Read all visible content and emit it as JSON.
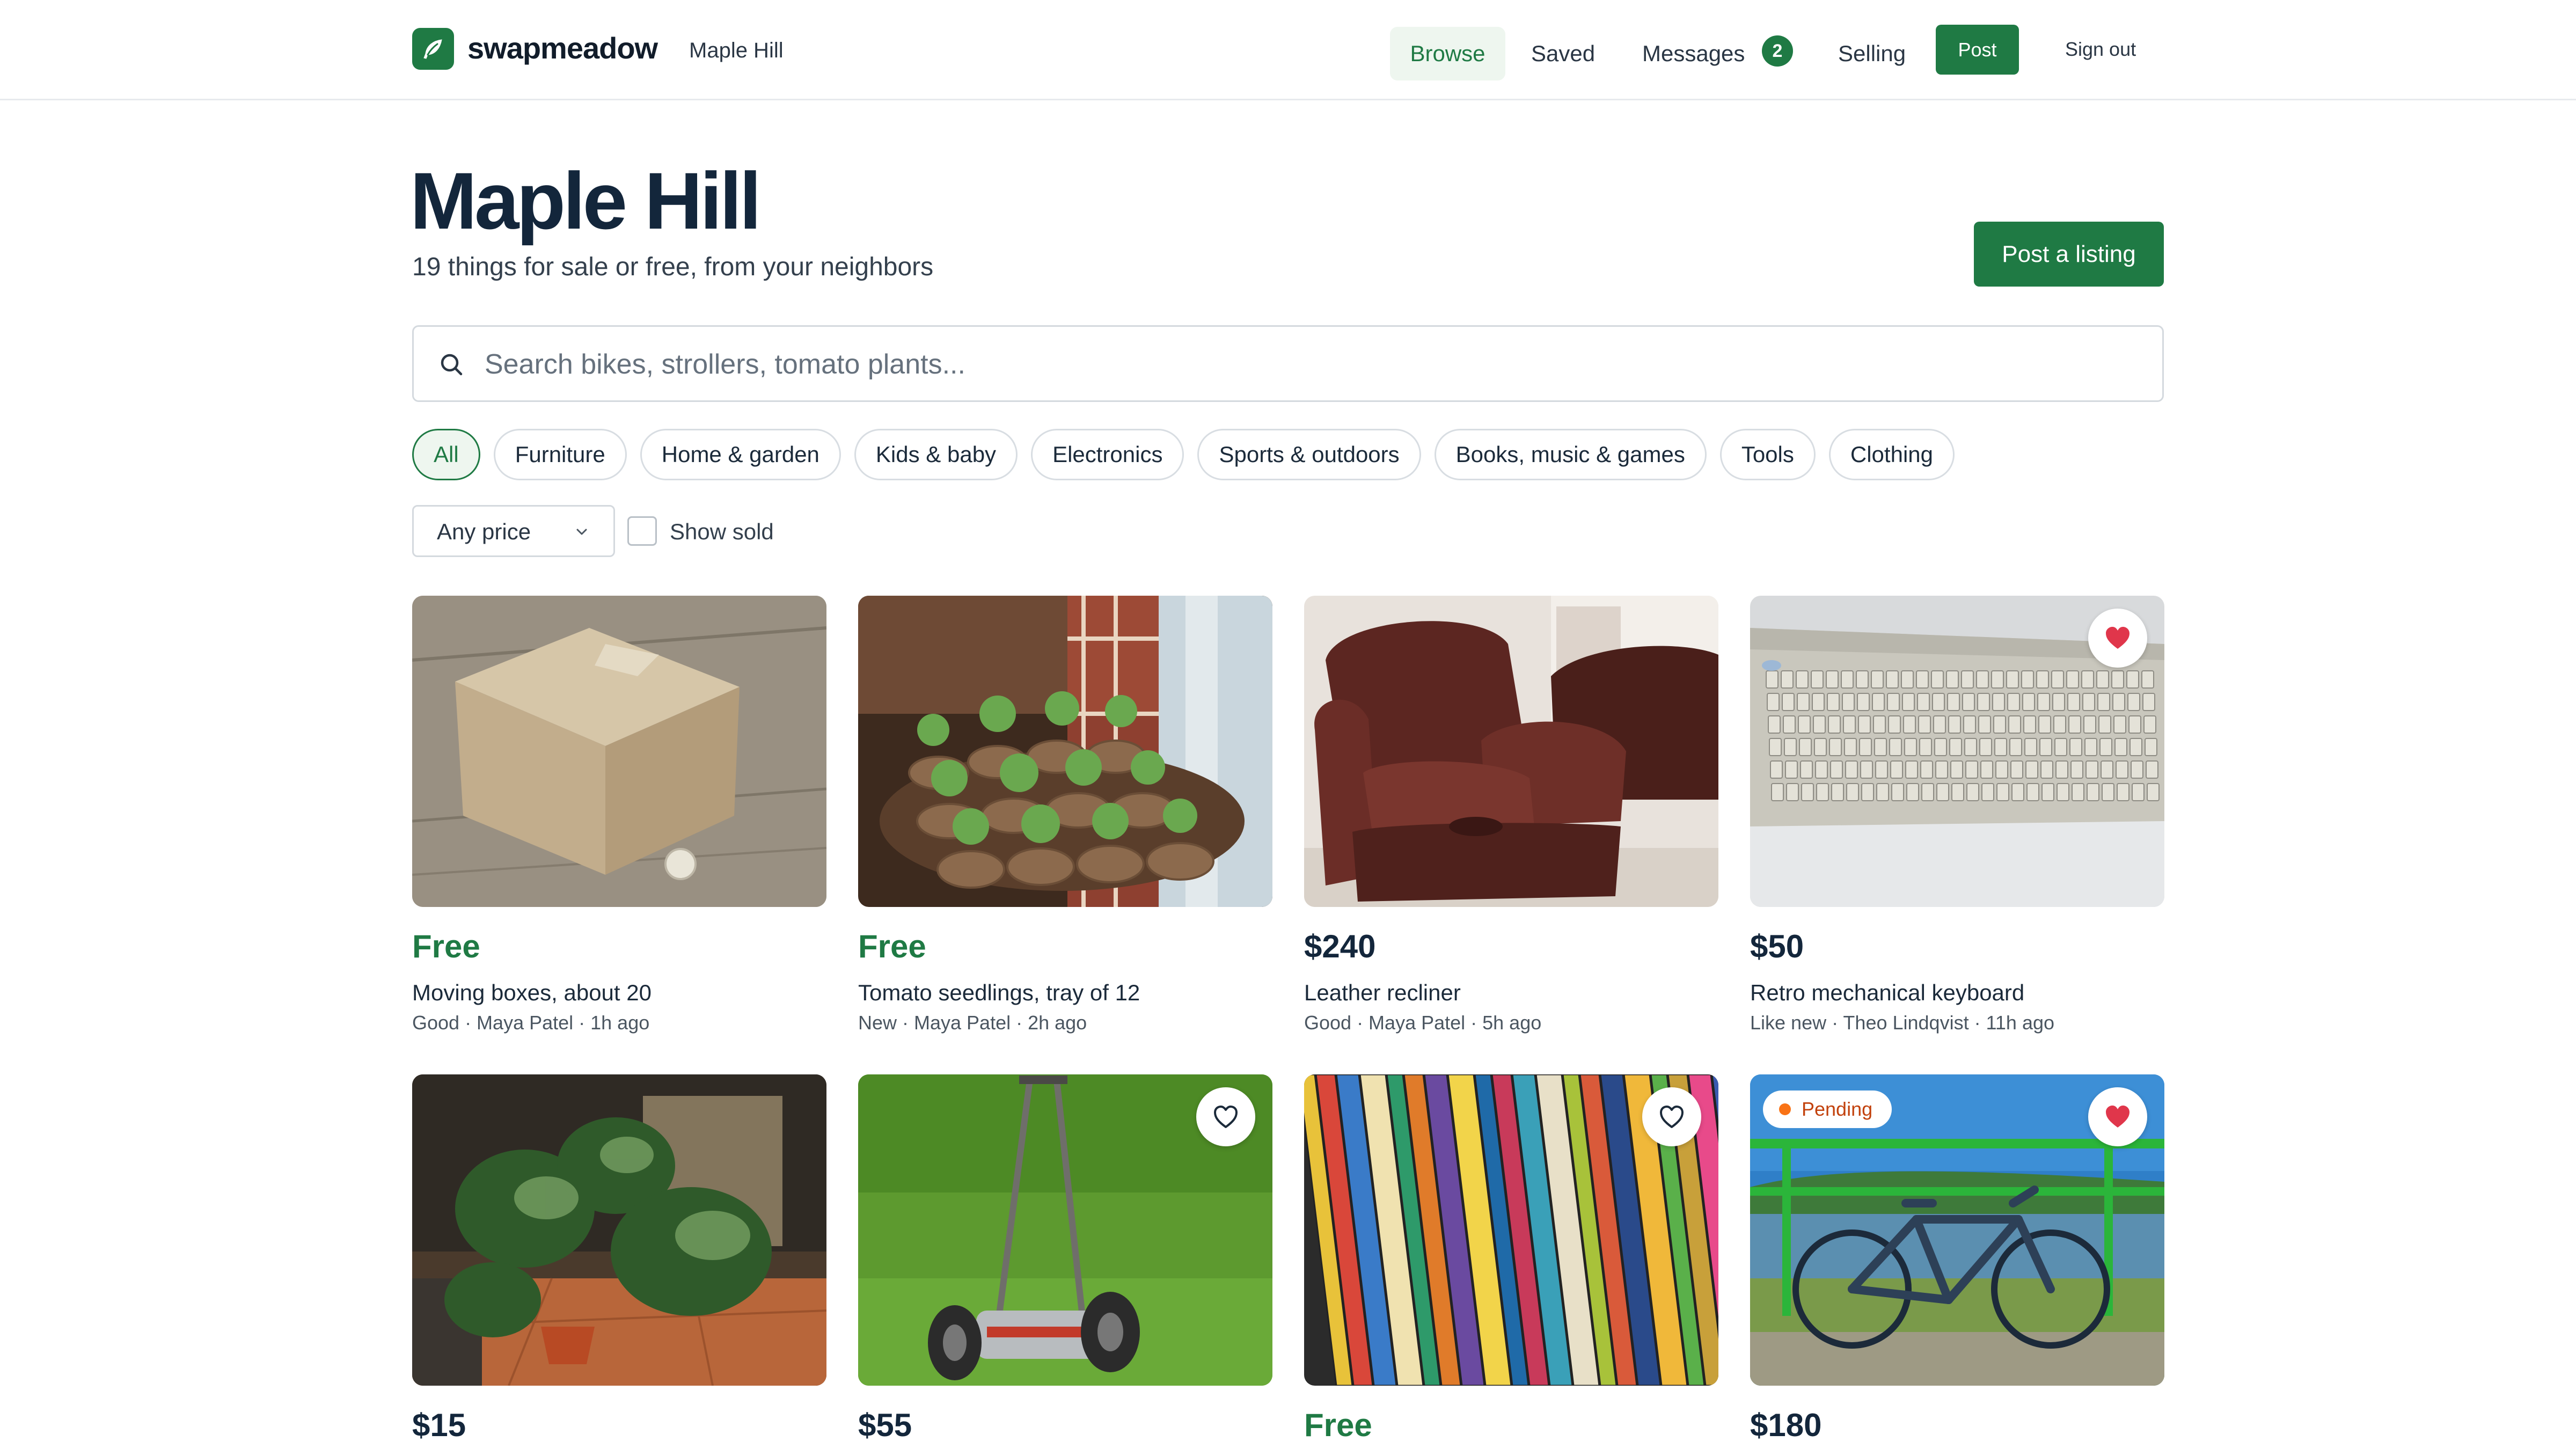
{
  "header": {
    "brand": "swapmeadow",
    "location": "Maple Hill",
    "nav": {
      "browse": "Browse",
      "saved": "Saved",
      "messages": "Messages",
      "messages_count": "2",
      "selling": "Selling",
      "post": "Post",
      "sign_out": "Sign out"
    },
    "logo_icon": "leaf-icon",
    "accent_color": "#1f7a44"
  },
  "hero": {
    "title": "Maple Hill",
    "subtitle": "19 things for sale or free, from your neighbors",
    "post_listing": "Post a listing"
  },
  "search": {
    "placeholder": "Search bikes, strollers, tomato plants...",
    "value": "",
    "icon": "search-icon"
  },
  "categories": [
    {
      "label": "All",
      "active": true
    },
    {
      "label": "Furniture"
    },
    {
      "label": "Home & garden"
    },
    {
      "label": "Kids & baby"
    },
    {
      "label": "Electronics"
    },
    {
      "label": "Sports & outdoors"
    },
    {
      "label": "Books, music & games"
    },
    {
      "label": "Tools"
    },
    {
      "label": "Clothing"
    }
  ],
  "filters": {
    "price": "Any price",
    "show_sold": "Show sold",
    "show_sold_checked": false
  },
  "listings": [
    {
      "price": "Free",
      "title": "Moving boxes, about 20",
      "meta": "Good · Maya Patel · 1h ago",
      "saved": false
    },
    {
      "price": "Free",
      "title": "Tomato seedlings, tray of 12",
      "meta": "New · Maya Patel · 2h ago",
      "saved": false
    },
    {
      "price": "$240",
      "title": "Leather recliner",
      "meta": "Good · Maya Patel · 5h ago",
      "saved": false
    },
    {
      "price": "$50",
      "title": "Retro mechanical keyboard",
      "meta": "Like new · Theo Lindqvist · 11h ago",
      "saved": true
    },
    {
      "price": "$15",
      "saved": false
    },
    {
      "price": "$55",
      "saved": false
    },
    {
      "price": "Free",
      "saved": false
    },
    {
      "price": "$180",
      "status": "Pending",
      "saved": true
    }
  ]
}
